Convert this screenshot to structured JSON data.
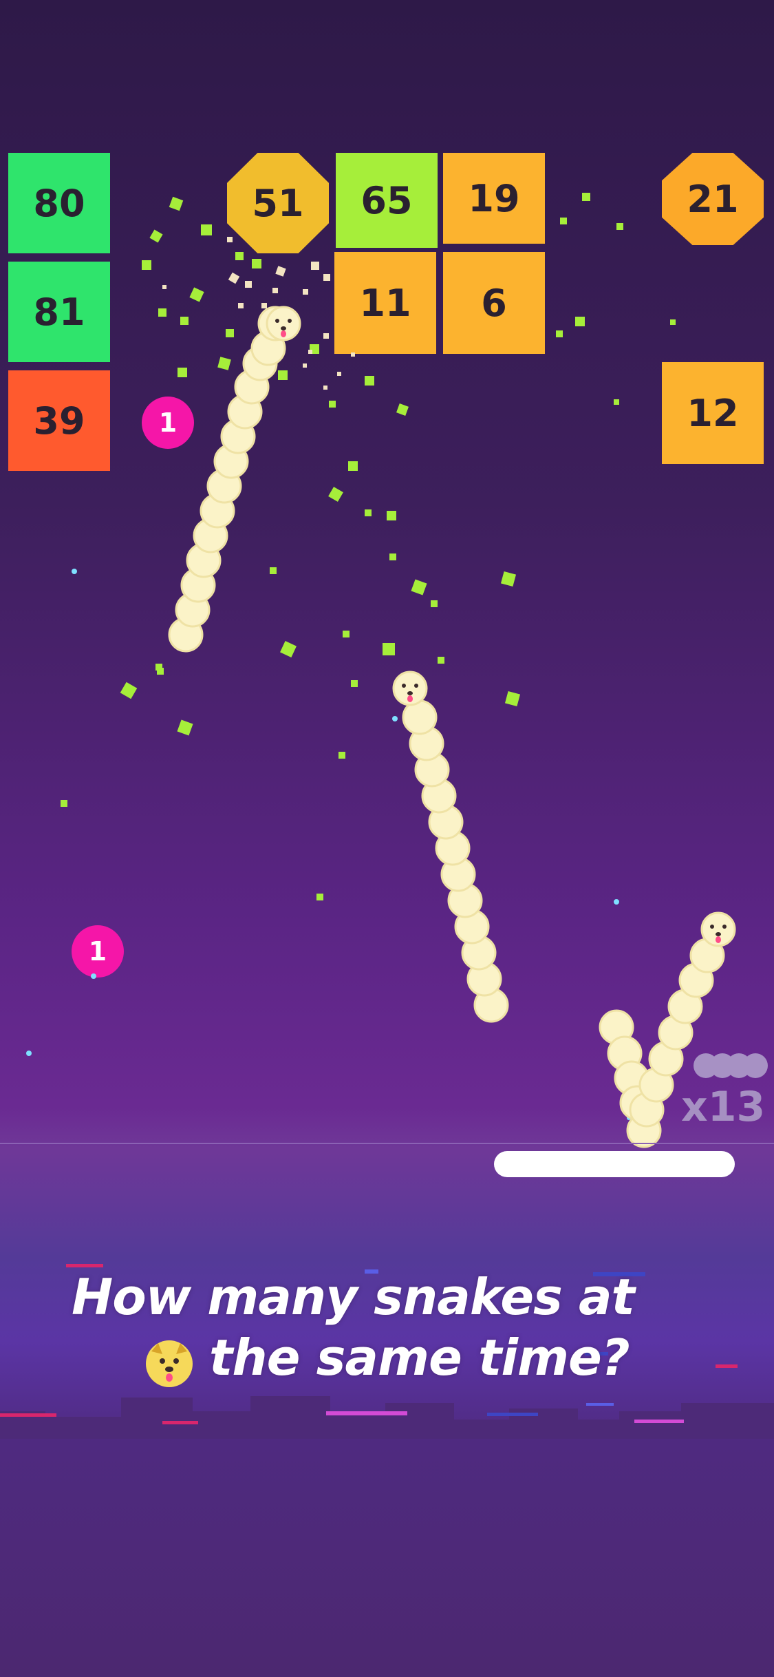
{
  "blocks": [
    {
      "value": "80",
      "color": "#2fe46c"
    },
    {
      "value": "81",
      "color": "#2fe46c"
    },
    {
      "value": "39",
      "color": "#ff5a2e"
    },
    {
      "value": "51",
      "color": "#f1bd2d"
    },
    {
      "value": "65",
      "color": "#a6ee3a"
    },
    {
      "value": "19",
      "color": "#fcb32f"
    },
    {
      "value": "11",
      "color": "#fcb32f"
    },
    {
      "value": "6",
      "color": "#fcb32f"
    },
    {
      "value": "21",
      "color": "#fca929"
    },
    {
      "value": "12",
      "color": "#fcb32f"
    }
  ],
  "coins": [
    {
      "value": "1"
    },
    {
      "value": "1"
    }
  ],
  "snake_counter": {
    "label": "x13"
  },
  "caption": {
    "line1": "How many snakes at",
    "line2": "the same time?"
  },
  "colors": {
    "background_top": "#2e1948",
    "background_mid": "#5b2585",
    "coin": "#f516a8",
    "snake_body": "#fbf3c8",
    "particle": "#a6ee3a",
    "paddle": "#ffffff"
  },
  "icons": [
    "dog-face-icon",
    "snake-pips-icon"
  ]
}
